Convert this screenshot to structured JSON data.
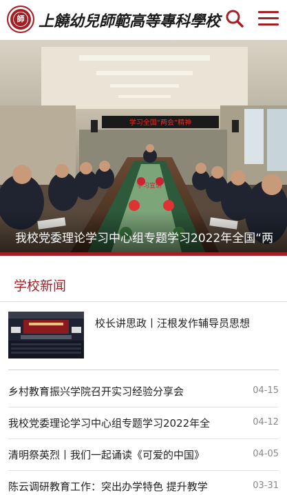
{
  "header": {
    "logo_text": "師",
    "title": "上饒幼兒師範高等專科學校"
  },
  "banner": {
    "caption": "我校党委理论学习中心组专题学习2022年全国“两",
    "screen_text": "学习全国“两会”精神",
    "table_sign": "学习宣讲"
  },
  "news_section": {
    "title": "学校新闻"
  },
  "featured": {
    "title": "校长讲思政丨汪根发作辅导员思想"
  },
  "news": [
    {
      "title": "乡村教育振兴学院召开实习经验分享会",
      "date": "04-15"
    },
    {
      "title": "我校党委理论学习中心组专题学习2022年全",
      "date": "04-12"
    },
    {
      "title": "清明祭英烈丨我们一起诵读《可爱的中国》",
      "date": "04-05"
    },
    {
      "title": "陈云调研教育工作：突出办学特色 提升教学",
      "date": "03-31"
    }
  ],
  "colors": {
    "brand_red": "#a31f24"
  },
  "icons": {
    "search": "search-icon",
    "menu": "menu-icon"
  }
}
